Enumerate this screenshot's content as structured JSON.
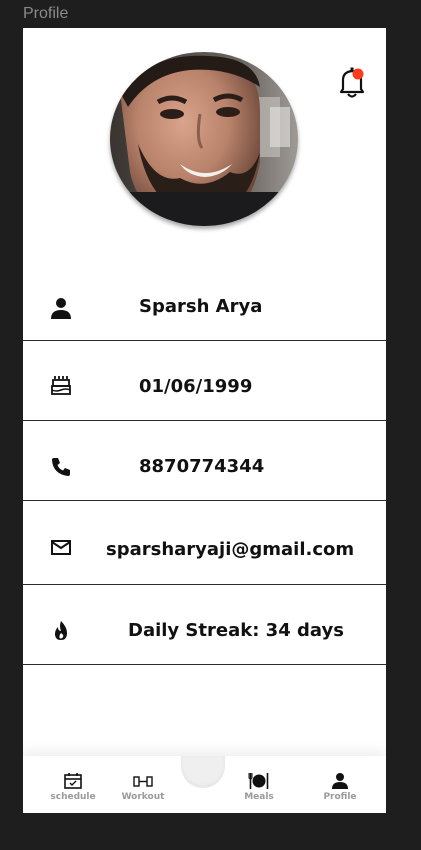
{
  "frame": {
    "label": "Profile"
  },
  "profile": {
    "name": "Sparsh Arya",
    "dob": "01/06/1999",
    "phone": "8870774344",
    "email": "sparsharyaji@gmail.com",
    "streak": "Daily Streak: 34 days"
  },
  "icons": {
    "bell": "bell-icon",
    "person": "person-icon",
    "cake": "cake-icon",
    "phone": "phone-icon",
    "mail": "mail-icon",
    "fire": "fire-icon"
  },
  "notification": {
    "dot_color": "#ff3b1f"
  },
  "nav": {
    "items": [
      {
        "label": "schedule",
        "icon": "calendar-icon"
      },
      {
        "label": "Workout",
        "icon": "dumbbell-icon"
      },
      {
        "label": "Meals",
        "icon": "plate-icon"
      },
      {
        "label": "Profile",
        "icon": "person-icon"
      }
    ]
  }
}
